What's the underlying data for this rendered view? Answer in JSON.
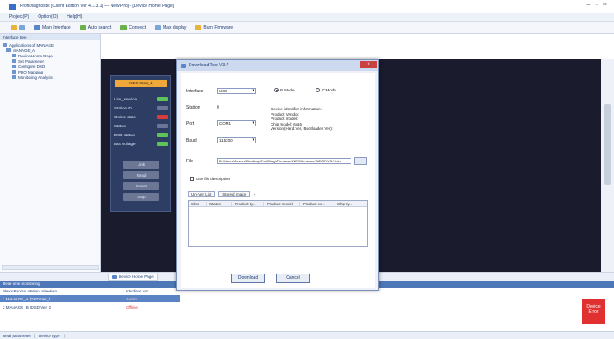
{
  "window": {
    "title": "ProfiDiagnostic [Client Edition Ver 4.1.3.1] — New Proj - [Device Home Page]",
    "controls": [
      "–",
      "▫",
      "×"
    ]
  },
  "menu": [
    "Project(P)",
    "Option(O)",
    "Help(H)"
  ],
  "toolbar": [
    {
      "label": "",
      "icon": "new-icon"
    },
    {
      "label": "Main Interface",
      "icon": "home-icon"
    },
    {
      "label": "Auto search",
      "icon": "search-icon"
    },
    {
      "label": "Connect",
      "icon": "connect-icon"
    },
    {
      "label": "Max display",
      "icon": "display-icon"
    },
    {
      "label": "Burn Firmware",
      "icon": "burn-icon"
    }
  ],
  "left_pane": {
    "header": "Interface tree",
    "tree": [
      "Applications of MANAGE",
      "MANAGE_A",
      "Device Home Page",
      "Set Parameter",
      "Configure DSD",
      "PDO Mapping",
      "Monitoring Analysis"
    ]
  },
  "device_panel": {
    "title": "NEO Start_1",
    "rows": [
      {
        "label": "Link_service",
        "state": "green"
      },
      {
        "label": "Station ID",
        "state": "gray"
      },
      {
        "label": "Online state",
        "state": "red"
      },
      {
        "label": "Status",
        "state": "gray"
      },
      {
        "label": "DSD status",
        "state": "green"
      },
      {
        "label": "Bus voltage",
        "state": "green"
      }
    ],
    "buttons": [
      "Link",
      "Read",
      "Reset",
      "Stop"
    ]
  },
  "tabs": {
    "active": "Device Home Page"
  },
  "status": {
    "header": "Real-time monitoring",
    "columns": [
      "Slave Device station, situation",
      "Interface ver",
      ""
    ],
    "rows": [
      {
        "name": "1  MANAGE_A (DSD,Ver_1",
        "state": "Alarm"
      },
      {
        "name": "2  MANAGE_B (DSD,Ver_2",
        "state": "Offline"
      }
    ],
    "badge": "Device Error"
  },
  "bottom_tabs": [
    "Real parameter",
    "Device type"
  ],
  "dialog": {
    "title": "Download Tool V3.7",
    "fields": {
      "interface_label": "Interface",
      "interface_value": "USB",
      "station_label": "Station",
      "station_value": "0",
      "port_label": "Port",
      "port_value": "COM1",
      "baud_label": "Baud",
      "baud_value": "115200",
      "file_label": "File",
      "file_value": "D:\\Users\\Fovera\\Desktop\\ProfiDiag\\Firmware\\NEO\\firmware\\NEOP\\V3.7.bin"
    },
    "radios": [
      {
        "label": "B Mode",
        "on": true
      },
      {
        "label": "C Mode",
        "on": false
      }
    ],
    "info_lines": [
      "Device identifier information:",
      "Product Vendor:",
      "Product model:",
      "Chip model: 6x16",
      "Version(Hard.Ver, Bootloader Ver):"
    ],
    "checkbox_label": "Use file description",
    "toolbar_items": [
      "Un-Ver List",
      "Stored Image",
      "• "
    ],
    "grid_columns": [
      "Slot",
      "Status",
      "Product ty...",
      "Product model",
      "Product ve...",
      "Ship ty..."
    ],
    "buttons": {
      "download": "Download",
      "cancel": "Cancel"
    }
  }
}
